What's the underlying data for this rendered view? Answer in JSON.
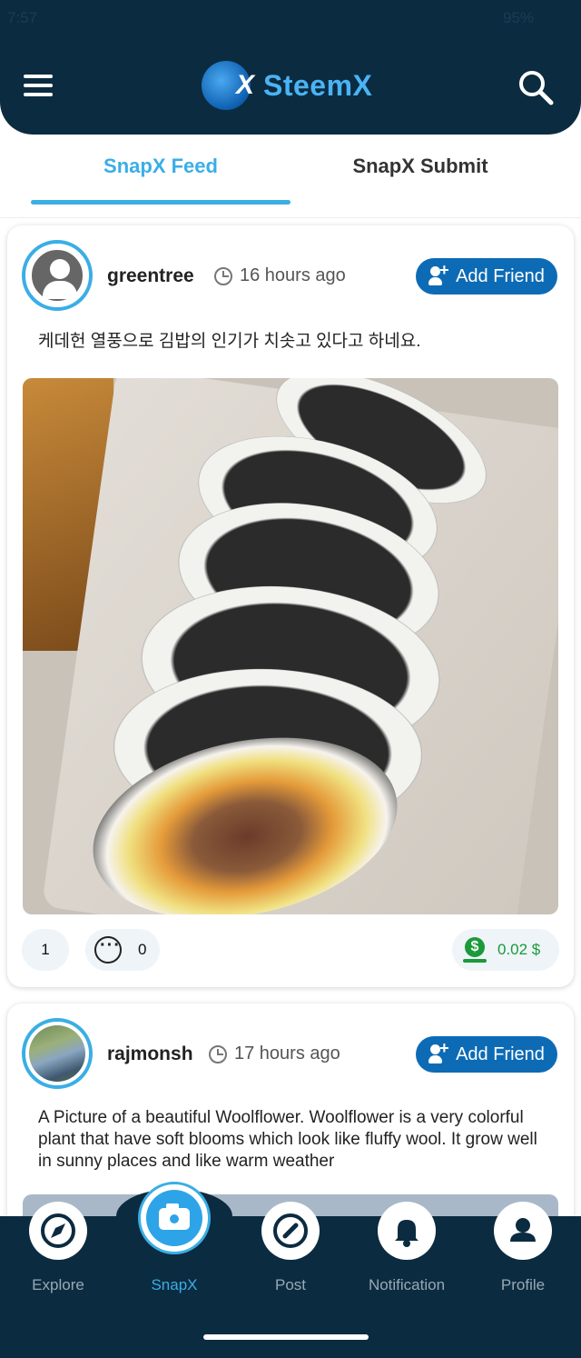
{
  "status_bar": {
    "time": "7:57",
    "battery": "95%"
  },
  "header": {
    "brand": "SteemX"
  },
  "tabs": [
    {
      "label": "SnapX Feed",
      "active": true
    },
    {
      "label": "SnapX Submit",
      "active": false
    }
  ],
  "posts": [
    {
      "username": "greentree",
      "time": "16 hours ago",
      "add_friend_label": "Add Friend",
      "text": "케데헌 열풍으로 김밥의 인기가 치솟고 있다고 하네요.",
      "likes": "1",
      "comments": "0",
      "payout": "0.02 $"
    },
    {
      "username": "rajmonsh",
      "time": "17 hours ago",
      "add_friend_label": "Add Friend",
      "text": "A Picture of a beautiful Woolflower. Woolflower is a very colorful plant that have soft blooms which look like fluffy wool. It grow well in sunny places and like warm weather"
    }
  ],
  "bottom_nav": [
    {
      "label": "Explore",
      "icon": "compass-icon"
    },
    {
      "label": "SnapX",
      "icon": "camera-icon",
      "active": true
    },
    {
      "label": "Post",
      "icon": "edit-icon"
    },
    {
      "label": "Notification",
      "icon": "bell-icon"
    },
    {
      "label": "Profile",
      "icon": "user-icon"
    }
  ],
  "colors": {
    "header_bg": "#0b2b40",
    "accent": "#3aaee6",
    "button": "#0d6bb5",
    "payout": "#1a9a3a"
  }
}
